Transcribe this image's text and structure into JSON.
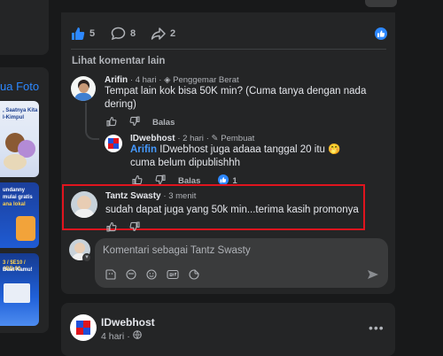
{
  "left": {
    "card_label": "ua Foto",
    "thumb1_lines": [
      ", Saatnya Kita",
      "l-Kimpul"
    ],
    "thumb2_lines": [
      "undanny",
      "mulai gratis",
      "ana lokal"
    ],
    "thumb3_lines": [
      "3 / $E10 / #BB.00",
      "Buat Kamu!"
    ]
  },
  "post": {
    "reactions": {
      "like_count": "5",
      "comment_count": "8",
      "share_count": "2"
    },
    "view_more_comments": "Lihat komentar lain",
    "comments": [
      {
        "name": "Arifin",
        "time": "4 hari",
        "badge": "Penggemar Berat",
        "text": "Tempat lain kok bisa 50K min? (Cuma tanya dengan nada dering)",
        "reply_label": "Balas"
      },
      {
        "name": "IDwebhost",
        "time": "2 hari",
        "badge": "Pembuat",
        "mention": "Arifin",
        "text": " IDwebhost juga adaaa tanggal 20 itu 🤭 cuma belum dipublishhh",
        "reply_label": "Balas",
        "like_count": "1"
      },
      {
        "name": "Tantz Swasty",
        "time": "3 menit",
        "text": "sudah dapat juga yang 50k min...terima kasih promonya"
      }
    ],
    "composer": {
      "placeholder": "Komentari sebagai Tantz Swasty"
    }
  },
  "next_post": {
    "author": "IDwebhost",
    "time": "4 hari",
    "more": "•••"
  },
  "colors": {
    "accent": "#2d88ff",
    "highlight_border": "#e0141e",
    "card_bg": "#242526",
    "page_bg": "#18191a"
  }
}
